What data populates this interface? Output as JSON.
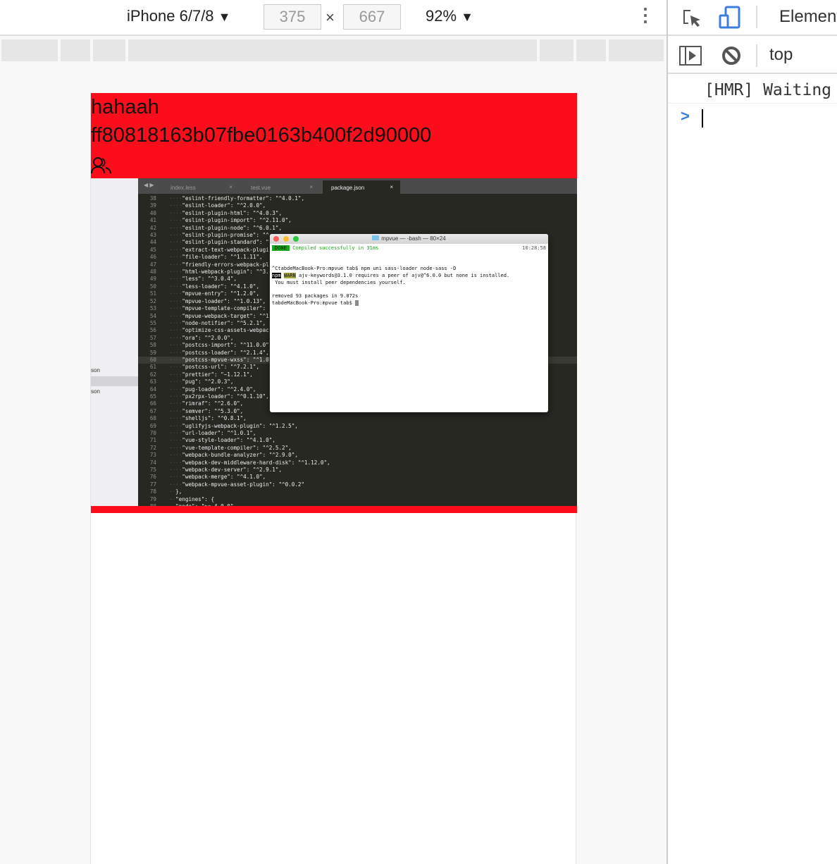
{
  "toolbar": {
    "device": "iPhone 6/7/8",
    "width": "375",
    "height": "667",
    "times": "×",
    "zoom": "92%",
    "caret": "▼",
    "more": "⋮"
  },
  "page": {
    "title": "hahaah",
    "id": "ff80818163b07fbe0163b400f2d90000",
    "icon": "users-icon",
    "accent": "#fc0d1b"
  },
  "editor": {
    "sidebar": [
      "son",
      "son"
    ],
    "tabs": [
      {
        "label": "index.less",
        "close": "×"
      },
      {
        "label": "test.vue",
        "close": "×"
      },
      {
        "label": "package.json",
        "close": "×"
      }
    ],
    "arrows": "◀ ▶",
    "lines": [
      [
        "38",
        "\"eslint-friendly-formatter\": \"^4.0.1\","
      ],
      [
        "39",
        "\"eslint-loader\": \"^2.0.0\","
      ],
      [
        "40",
        "\"eslint-plugin-html\": \"^4.0.3\","
      ],
      [
        "41",
        "\"eslint-plugin-import\": \"^2.11.0\","
      ],
      [
        "42",
        "\"eslint-plugin-node\": \"^6.0.1\","
      ],
      [
        "43",
        "\"eslint-plugin-promise\": \"^"
      ],
      [
        "44",
        "\"eslint-plugin-standard\": \""
      ],
      [
        "45",
        "\"extract-text-webpack-plugi"
      ],
      [
        "46",
        "\"file-loader\": \"^1.1.11\","
      ],
      [
        "47",
        "\"friendly-errors-webpack-pl"
      ],
      [
        "48",
        "\"html-webpack-plugin\": \"^3."
      ],
      [
        "49",
        "\"less\": \"^3.0.4\","
      ],
      [
        "50",
        "\"less-loader\": \"^4.1.0\","
      ],
      [
        "51",
        "\"mpvue-entry\": \"^1.2.0\","
      ],
      [
        "52",
        "\"mpvue-loader\": \"^1.0.13\","
      ],
      [
        "53",
        "\"mpvue-template-compiler\": \""
      ],
      [
        "54",
        "\"mpvue-webpack-target\": \"^1"
      ],
      [
        "55",
        "\"node-notifier\": \"^5.2.1\","
      ],
      [
        "56",
        "\"optimize-css-assets-webpac"
      ],
      [
        "57",
        "\"ora\": \"^2.0.0\","
      ],
      [
        "58",
        "\"postcss-import\": \"^11.0.0\""
      ],
      [
        "59",
        "\"postcss-loader\": \"^2.1.4\","
      ],
      [
        "60",
        "\"postcss-mpvue-wxss\": \"^1.0"
      ],
      [
        "61",
        "\"postcss-url\": \"^7.2.1\","
      ],
      [
        "62",
        "\"prettier\": \"~1.12.1\","
      ],
      [
        "63",
        "\"pug\": \"^2.0.3\","
      ],
      [
        "64",
        "\"pug-loader\": \"^2.4.0\","
      ],
      [
        "65",
        "\"px2rpx-loader\": \"^0.1.10\","
      ],
      [
        "66",
        "\"rimraf\": \"^2.6.0\","
      ],
      [
        "67",
        "\"semver\": \"^5.3.0\","
      ],
      [
        "68",
        "\"shelljs\": \"^0.8.1\","
      ],
      [
        "69",
        "\"uglifyjs-webpack-plugin\": \"^1.2.5\","
      ],
      [
        "70",
        "\"url-loader\": \"^1.0.1\","
      ],
      [
        "71",
        "\"vue-style-loader\": \"^4.1.0\","
      ],
      [
        "72",
        "\"vue-template-compiler\": \"^2.5.2\","
      ],
      [
        "73",
        "\"webpack-bundle-analyzer\": \"^2.9.0\","
      ],
      [
        "74",
        "\"webpack-dev-middleware-hard-disk\": \"^1.12.0\","
      ],
      [
        "75",
        "\"webpack-dev-server\": \"^2.9.1\","
      ],
      [
        "76",
        "\"webpack-merge\": \"^4.1.0\","
      ],
      [
        "77",
        "\"webpack-mpvue-asset-plugin\": \"^0.0.2\""
      ],
      [
        "78",
        "},"
      ],
      [
        "79",
        "\"engines\": {"
      ],
      [
        "80",
        "\"node\": \">= 4.0.0\""
      ]
    ]
  },
  "terminal": {
    "title": "mpvue — -bash — 80×24",
    "done": "DONE",
    "compiled": "Compiled successfully in 31ms",
    "time": "10:28:58",
    "cmd": "^CtabdeMacBook-Pro:mpvue tab$ npm uni sass-loader node-sass -D",
    "npm": "npm",
    "warn": "WARN",
    "warn_msg": " ajv-keywords@3.1.0 requires a peer of ajv@^6.0.0 but none is installed.",
    "warn_msg2": " You must install peer dependencies yourself.",
    "removed": "removed 93 packages in 9.072s",
    "prompt": "tabdeMacBook-Pro:mpvue tab$ "
  },
  "devtools": {
    "tab": "Elements",
    "context": "top",
    "log": "[HMR] Waiting",
    "prompt": ">"
  }
}
